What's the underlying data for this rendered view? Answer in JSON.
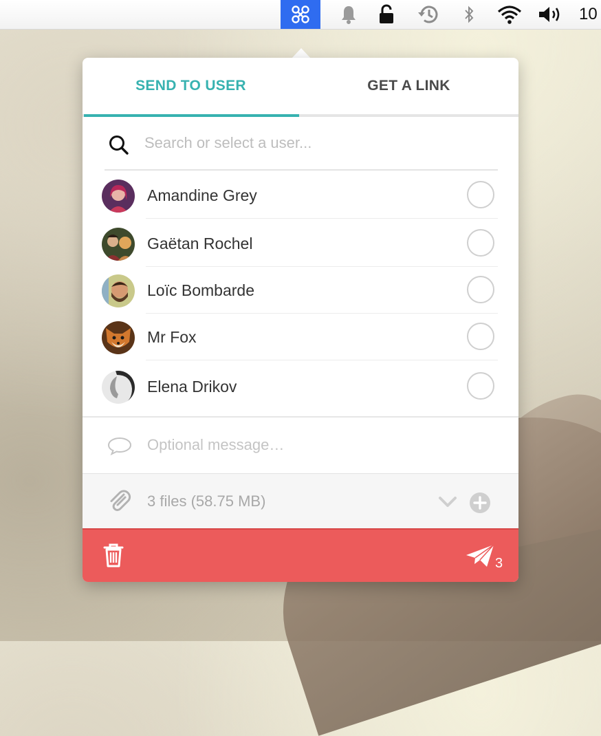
{
  "menubar": {
    "clock": "10",
    "icons": [
      "app-icon",
      "bell-icon",
      "lock-icon",
      "time-machine-icon",
      "bluetooth-icon",
      "wifi-icon",
      "volume-icon"
    ]
  },
  "tabs": [
    {
      "label": "SEND TO USER",
      "active": true
    },
    {
      "label": "GET A LINK",
      "active": false
    }
  ],
  "search": {
    "placeholder": "Search or select a user..."
  },
  "users": [
    {
      "name": "Amandine Grey",
      "selected": false
    },
    {
      "name": "Gaëtan Rochel",
      "selected": false
    },
    {
      "name": "Loïc Bombarde",
      "selected": false
    },
    {
      "name": "Mr Fox",
      "selected": false
    },
    {
      "name": "Elena Drikov",
      "selected": false
    }
  ],
  "message": {
    "placeholder": "Optional message…"
  },
  "files": {
    "summary": "3 files (58.75 MB)"
  },
  "footer": {
    "send_count": "3"
  },
  "colors": {
    "accent": "#37b2b0",
    "footer": "#ec5b5b",
    "menu_app": "#2f6cf0"
  }
}
